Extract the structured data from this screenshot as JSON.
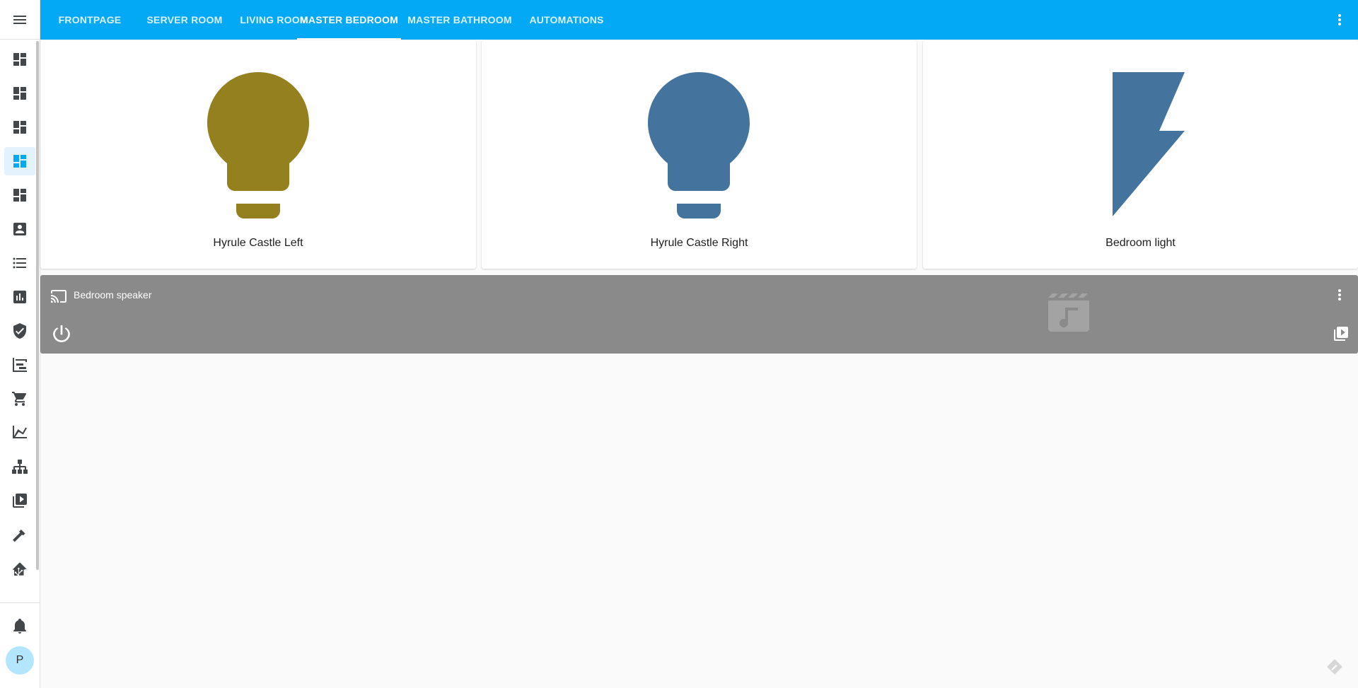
{
  "header": {
    "tabs": [
      {
        "label": "FRONTPAGE",
        "active": false
      },
      {
        "label": "SERVER ROOM",
        "active": false
      },
      {
        "label": "LIVING ROOM",
        "active": false
      },
      {
        "label": "MASTER BEDROOM",
        "active": true
      },
      {
        "label": "MASTER BATHROOM",
        "active": false
      },
      {
        "label": "AUTOMATIONS",
        "active": false
      }
    ],
    "menu_icon": "dots-vertical-icon"
  },
  "sidebar": {
    "menu_icon": "hamburger-menu-icon",
    "items": [
      {
        "icon": "dashboard-icon",
        "active": false
      },
      {
        "icon": "dashboard-icon",
        "active": false
      },
      {
        "icon": "dashboard-icon",
        "active": false
      },
      {
        "icon": "dashboard-icon",
        "active": true
      },
      {
        "icon": "dashboard-icon",
        "active": false
      },
      {
        "icon": "account-box-icon",
        "active": false
      },
      {
        "icon": "format-list-icon",
        "active": false
      },
      {
        "icon": "chart-box-icon",
        "active": false
      },
      {
        "icon": "shield-check-icon",
        "active": false
      },
      {
        "icon": "chart-timeline-icon",
        "active": false
      },
      {
        "icon": "cart-icon",
        "active": false
      },
      {
        "icon": "chart-line-icon",
        "active": false
      },
      {
        "icon": "sitemap-icon",
        "active": false
      },
      {
        "icon": "play-box-multiple-icon",
        "active": false
      },
      {
        "icon": "hammer-icon",
        "active": false
      },
      {
        "icon": "home-assistant-icon",
        "active": false
      }
    ],
    "notifications_icon": "bell-icon",
    "avatar_initial": "P"
  },
  "cards": [
    {
      "name": "Hyrule Castle Left",
      "icon": "lightbulb-icon",
      "color": "#958020"
    },
    {
      "name": "Hyrule Castle Right",
      "icon": "lightbulb-icon",
      "color": "#44739e"
    },
    {
      "name": "Bedroom light",
      "icon": "flash-icon",
      "color": "#44739e"
    }
  ],
  "media_player": {
    "name": "Bedroom speaker",
    "cast_icon": "cast-icon",
    "more_icon": "dots-vertical-icon",
    "power_icon": "power-icon",
    "browse_icon": "play-box-multiple-icon",
    "art_icon": "movie-music-icon",
    "background": "#8a8a8a"
  },
  "colors": {
    "accent": "#03a9f4",
    "active_bg": "#e3f2fd",
    "icon_default": "#44474a"
  }
}
